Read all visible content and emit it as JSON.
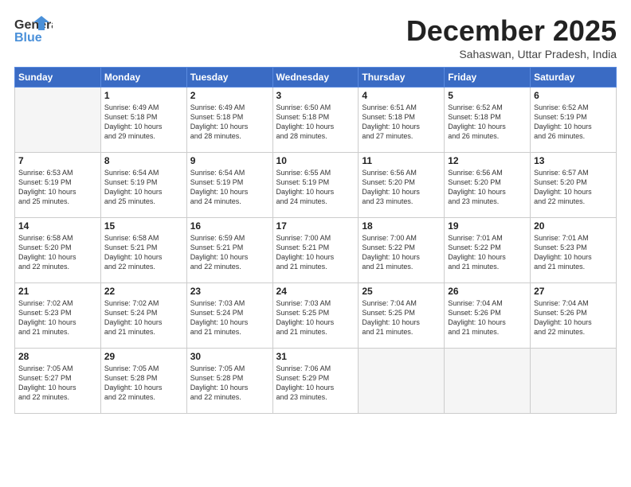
{
  "header": {
    "logo_line1": "General",
    "logo_line2": "Blue",
    "month": "December 2025",
    "location": "Sahaswan, Uttar Pradesh, India"
  },
  "days_of_week": [
    "Sunday",
    "Monday",
    "Tuesday",
    "Wednesday",
    "Thursday",
    "Friday",
    "Saturday"
  ],
  "weeks": [
    [
      {
        "day": "",
        "info": ""
      },
      {
        "day": "1",
        "info": "Sunrise: 6:49 AM\nSunset: 5:18 PM\nDaylight: 10 hours\nand 29 minutes."
      },
      {
        "day": "2",
        "info": "Sunrise: 6:49 AM\nSunset: 5:18 PM\nDaylight: 10 hours\nand 28 minutes."
      },
      {
        "day": "3",
        "info": "Sunrise: 6:50 AM\nSunset: 5:18 PM\nDaylight: 10 hours\nand 28 minutes."
      },
      {
        "day": "4",
        "info": "Sunrise: 6:51 AM\nSunset: 5:18 PM\nDaylight: 10 hours\nand 27 minutes."
      },
      {
        "day": "5",
        "info": "Sunrise: 6:52 AM\nSunset: 5:18 PM\nDaylight: 10 hours\nand 26 minutes."
      },
      {
        "day": "6",
        "info": "Sunrise: 6:52 AM\nSunset: 5:19 PM\nDaylight: 10 hours\nand 26 minutes."
      }
    ],
    [
      {
        "day": "7",
        "info": "Sunrise: 6:53 AM\nSunset: 5:19 PM\nDaylight: 10 hours\nand 25 minutes."
      },
      {
        "day": "8",
        "info": "Sunrise: 6:54 AM\nSunset: 5:19 PM\nDaylight: 10 hours\nand 25 minutes."
      },
      {
        "day": "9",
        "info": "Sunrise: 6:54 AM\nSunset: 5:19 PM\nDaylight: 10 hours\nand 24 minutes."
      },
      {
        "day": "10",
        "info": "Sunrise: 6:55 AM\nSunset: 5:19 PM\nDaylight: 10 hours\nand 24 minutes."
      },
      {
        "day": "11",
        "info": "Sunrise: 6:56 AM\nSunset: 5:20 PM\nDaylight: 10 hours\nand 23 minutes."
      },
      {
        "day": "12",
        "info": "Sunrise: 6:56 AM\nSunset: 5:20 PM\nDaylight: 10 hours\nand 23 minutes."
      },
      {
        "day": "13",
        "info": "Sunrise: 6:57 AM\nSunset: 5:20 PM\nDaylight: 10 hours\nand 22 minutes."
      }
    ],
    [
      {
        "day": "14",
        "info": "Sunrise: 6:58 AM\nSunset: 5:20 PM\nDaylight: 10 hours\nand 22 minutes."
      },
      {
        "day": "15",
        "info": "Sunrise: 6:58 AM\nSunset: 5:21 PM\nDaylight: 10 hours\nand 22 minutes."
      },
      {
        "day": "16",
        "info": "Sunrise: 6:59 AM\nSunset: 5:21 PM\nDaylight: 10 hours\nand 22 minutes."
      },
      {
        "day": "17",
        "info": "Sunrise: 7:00 AM\nSunset: 5:21 PM\nDaylight: 10 hours\nand 21 minutes."
      },
      {
        "day": "18",
        "info": "Sunrise: 7:00 AM\nSunset: 5:22 PM\nDaylight: 10 hours\nand 21 minutes."
      },
      {
        "day": "19",
        "info": "Sunrise: 7:01 AM\nSunset: 5:22 PM\nDaylight: 10 hours\nand 21 minutes."
      },
      {
        "day": "20",
        "info": "Sunrise: 7:01 AM\nSunset: 5:23 PM\nDaylight: 10 hours\nand 21 minutes."
      }
    ],
    [
      {
        "day": "21",
        "info": "Sunrise: 7:02 AM\nSunset: 5:23 PM\nDaylight: 10 hours\nand 21 minutes."
      },
      {
        "day": "22",
        "info": "Sunrise: 7:02 AM\nSunset: 5:24 PM\nDaylight: 10 hours\nand 21 minutes."
      },
      {
        "day": "23",
        "info": "Sunrise: 7:03 AM\nSunset: 5:24 PM\nDaylight: 10 hours\nand 21 minutes."
      },
      {
        "day": "24",
        "info": "Sunrise: 7:03 AM\nSunset: 5:25 PM\nDaylight: 10 hours\nand 21 minutes."
      },
      {
        "day": "25",
        "info": "Sunrise: 7:04 AM\nSunset: 5:25 PM\nDaylight: 10 hours\nand 21 minutes."
      },
      {
        "day": "26",
        "info": "Sunrise: 7:04 AM\nSunset: 5:26 PM\nDaylight: 10 hours\nand 21 minutes."
      },
      {
        "day": "27",
        "info": "Sunrise: 7:04 AM\nSunset: 5:26 PM\nDaylight: 10 hours\nand 22 minutes."
      }
    ],
    [
      {
        "day": "28",
        "info": "Sunrise: 7:05 AM\nSunset: 5:27 PM\nDaylight: 10 hours\nand 22 minutes."
      },
      {
        "day": "29",
        "info": "Sunrise: 7:05 AM\nSunset: 5:28 PM\nDaylight: 10 hours\nand 22 minutes."
      },
      {
        "day": "30",
        "info": "Sunrise: 7:05 AM\nSunset: 5:28 PM\nDaylight: 10 hours\nand 22 minutes."
      },
      {
        "day": "31",
        "info": "Sunrise: 7:06 AM\nSunset: 5:29 PM\nDaylight: 10 hours\nand 23 minutes."
      },
      {
        "day": "",
        "info": ""
      },
      {
        "day": "",
        "info": ""
      },
      {
        "day": "",
        "info": ""
      }
    ]
  ]
}
